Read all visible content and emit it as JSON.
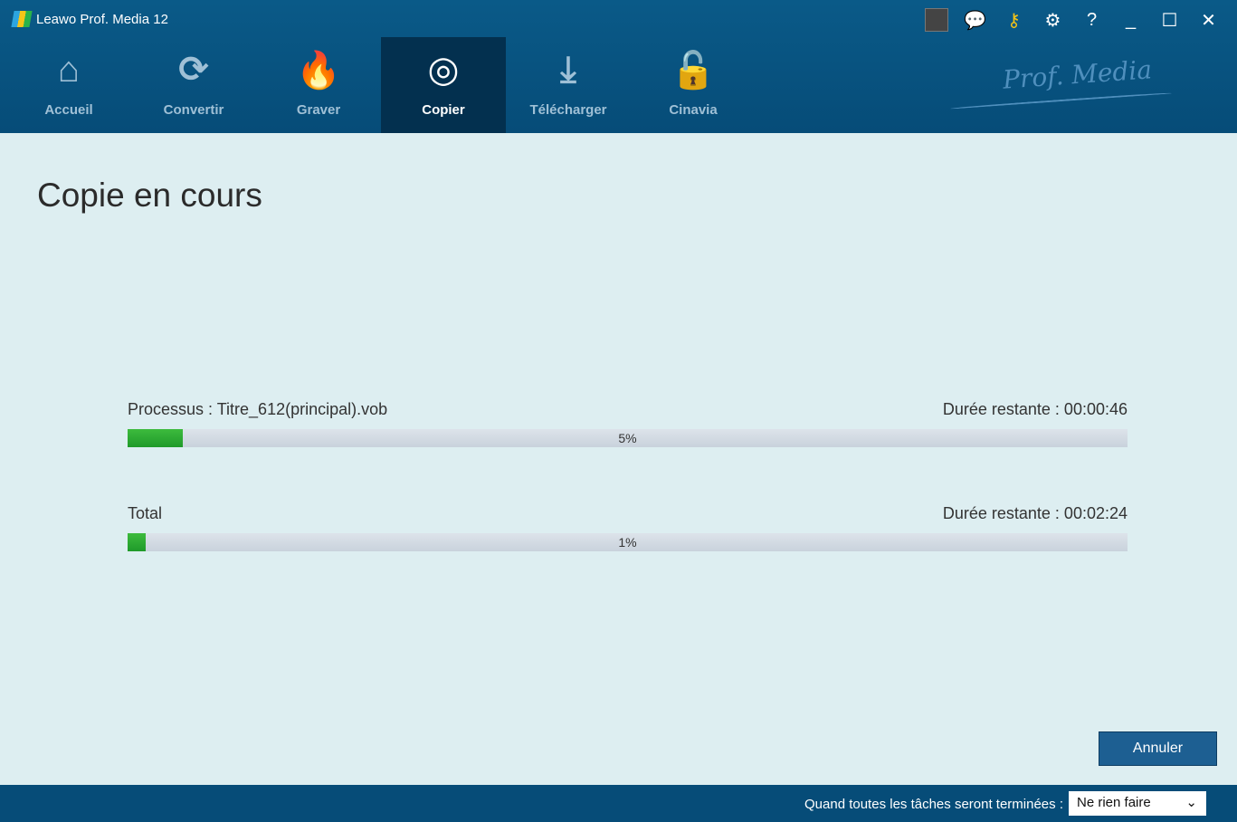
{
  "app": {
    "title": "Leawo Prof. Media 12",
    "brand": "Prof. Media"
  },
  "nav": [
    {
      "label": "Accueil",
      "icon": "⌂"
    },
    {
      "label": "Convertir",
      "icon": "⟳"
    },
    {
      "label": "Graver",
      "icon": "🔥"
    },
    {
      "label": "Copier",
      "icon": "◎"
    },
    {
      "label": "Télécharger",
      "icon": "⤓"
    },
    {
      "label": "Cinavia",
      "icon": "🔓"
    }
  ],
  "main": {
    "title": "Copie en cours",
    "process": {
      "label": "Processus : Titre_612(principal).vob",
      "remaining": "Durée restante : 00:00:46",
      "percent_label": "5%",
      "percent": 5.5
    },
    "total": {
      "label": "Total",
      "remaining": "Durée restante : 00:02:24",
      "percent_label": "1%",
      "percent": 1.8
    },
    "cancel": "Annuler"
  },
  "footer": {
    "label": "Quand toutes les tâches seront terminées :",
    "select": "Ne rien faire"
  }
}
